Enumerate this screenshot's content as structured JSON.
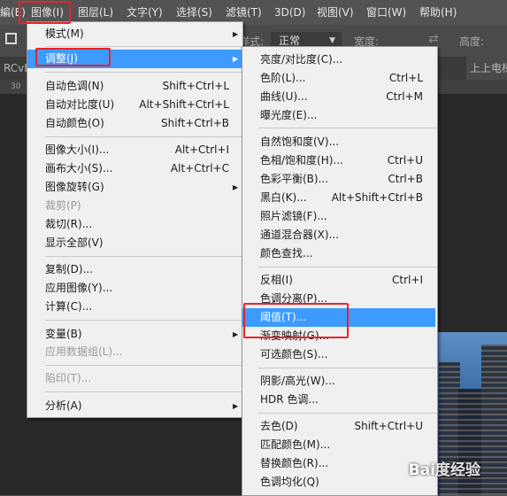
{
  "menubar": {
    "items": [
      {
        "label": "編(E)"
      },
      {
        "label": "图像(I)"
      },
      {
        "label": "图层(L)"
      },
      {
        "label": "文字(Y)"
      },
      {
        "label": "选择(S)"
      },
      {
        "label": "滤镜(T)"
      },
      {
        "label": "3D(D)"
      },
      {
        "label": "视图(V)"
      },
      {
        "label": "窗口(W)"
      },
      {
        "label": "帮助(H)"
      }
    ]
  },
  "options_bar": {
    "style_label": "样式:",
    "style_value": "正常",
    "width_label": "宽度:",
    "height_label": "高度:"
  },
  "tabs": [
    {
      "label": "RCvB"
    },
    {
      "label": "上上电梯"
    }
  ],
  "ruler": {
    "tick": "30"
  },
  "image_menu": {
    "items": [
      {
        "label": "模式(M)",
        "shortcut": "",
        "submenu": true,
        "disabled": false
      },
      {
        "label": "调整(J)",
        "shortcut": "",
        "submenu": true,
        "disabled": false
      },
      {
        "label": "自动色调(N)",
        "shortcut": "Shift+Ctrl+L",
        "submenu": false,
        "disabled": false
      },
      {
        "label": "自动对比度(U)",
        "shortcut": "Alt+Shift+Ctrl+L",
        "submenu": false,
        "disabled": false
      },
      {
        "label": "自动颜色(O)",
        "shortcut": "Shift+Ctrl+B",
        "submenu": false,
        "disabled": false
      },
      {
        "label": "图像大小(I)...",
        "shortcut": "Alt+Ctrl+I",
        "submenu": false,
        "disabled": false
      },
      {
        "label": "画布大小(S)...",
        "shortcut": "Alt+Ctrl+C",
        "submenu": false,
        "disabled": false
      },
      {
        "label": "图像旋转(G)",
        "shortcut": "",
        "submenu": true,
        "disabled": false
      },
      {
        "label": "裁剪(P)",
        "shortcut": "",
        "submenu": false,
        "disabled": true
      },
      {
        "label": "裁切(R)...",
        "shortcut": "",
        "submenu": false,
        "disabled": false
      },
      {
        "label": "显示全部(V)",
        "shortcut": "",
        "submenu": false,
        "disabled": false
      },
      {
        "label": "复制(D)...",
        "shortcut": "",
        "submenu": false,
        "disabled": false
      },
      {
        "label": "应用图像(Y)...",
        "shortcut": "",
        "submenu": false,
        "disabled": false
      },
      {
        "label": "计算(C)...",
        "shortcut": "",
        "submenu": false,
        "disabled": false
      },
      {
        "label": "变量(B)",
        "shortcut": "",
        "submenu": true,
        "disabled": false
      },
      {
        "label": "应用数据组(L)...",
        "shortcut": "",
        "submenu": false,
        "disabled": true
      },
      {
        "label": "陷印(T)...",
        "shortcut": "",
        "submenu": false,
        "disabled": true
      },
      {
        "label": "分析(A)",
        "shortcut": "",
        "submenu": true,
        "disabled": false
      }
    ]
  },
  "adjust_menu": {
    "items": [
      {
        "label": "亮度/对比度(C)...",
        "shortcut": ""
      },
      {
        "label": "色阶(L)...",
        "shortcut": "Ctrl+L"
      },
      {
        "label": "曲线(U)...",
        "shortcut": "Ctrl+M"
      },
      {
        "label": "曝光度(E)...",
        "shortcut": ""
      },
      {
        "label": "自然饱和度(V)...",
        "shortcut": ""
      },
      {
        "label": "色相/饱和度(H)...",
        "shortcut": "Ctrl+U"
      },
      {
        "label": "色彩平衡(B)...",
        "shortcut": "Ctrl+B"
      },
      {
        "label": "黑白(K)...",
        "shortcut": "Alt+Shift+Ctrl+B"
      },
      {
        "label": "照片滤镜(F)...",
        "shortcut": ""
      },
      {
        "label": "通道混合器(X)...",
        "shortcut": ""
      },
      {
        "label": "颜色查找...",
        "shortcut": ""
      },
      {
        "label": "反相(I)",
        "shortcut": "Ctrl+I"
      },
      {
        "label": "色调分离(P)...",
        "shortcut": ""
      },
      {
        "label": "阈值(T)...",
        "shortcut": ""
      },
      {
        "label": "渐变映射(G)...",
        "shortcut": ""
      },
      {
        "label": "可选颜色(S)...",
        "shortcut": ""
      },
      {
        "label": "阴影/高光(W)...",
        "shortcut": ""
      },
      {
        "label": "HDR 色调...",
        "shortcut": ""
      },
      {
        "label": "去色(D)",
        "shortcut": "Shift+Ctrl+U"
      },
      {
        "label": "匹配颜色(M)...",
        "shortcut": ""
      },
      {
        "label": "替换颜色(R)...",
        "shortcut": ""
      },
      {
        "label": "色调均化(Q)",
        "shortcut": ""
      }
    ]
  },
  "watermark": {
    "text": "Bai度经验"
  },
  "colors": {
    "highlight": "#3d9bff",
    "annotation": "#e8232a",
    "menu_bg": "#f0f0f0"
  }
}
